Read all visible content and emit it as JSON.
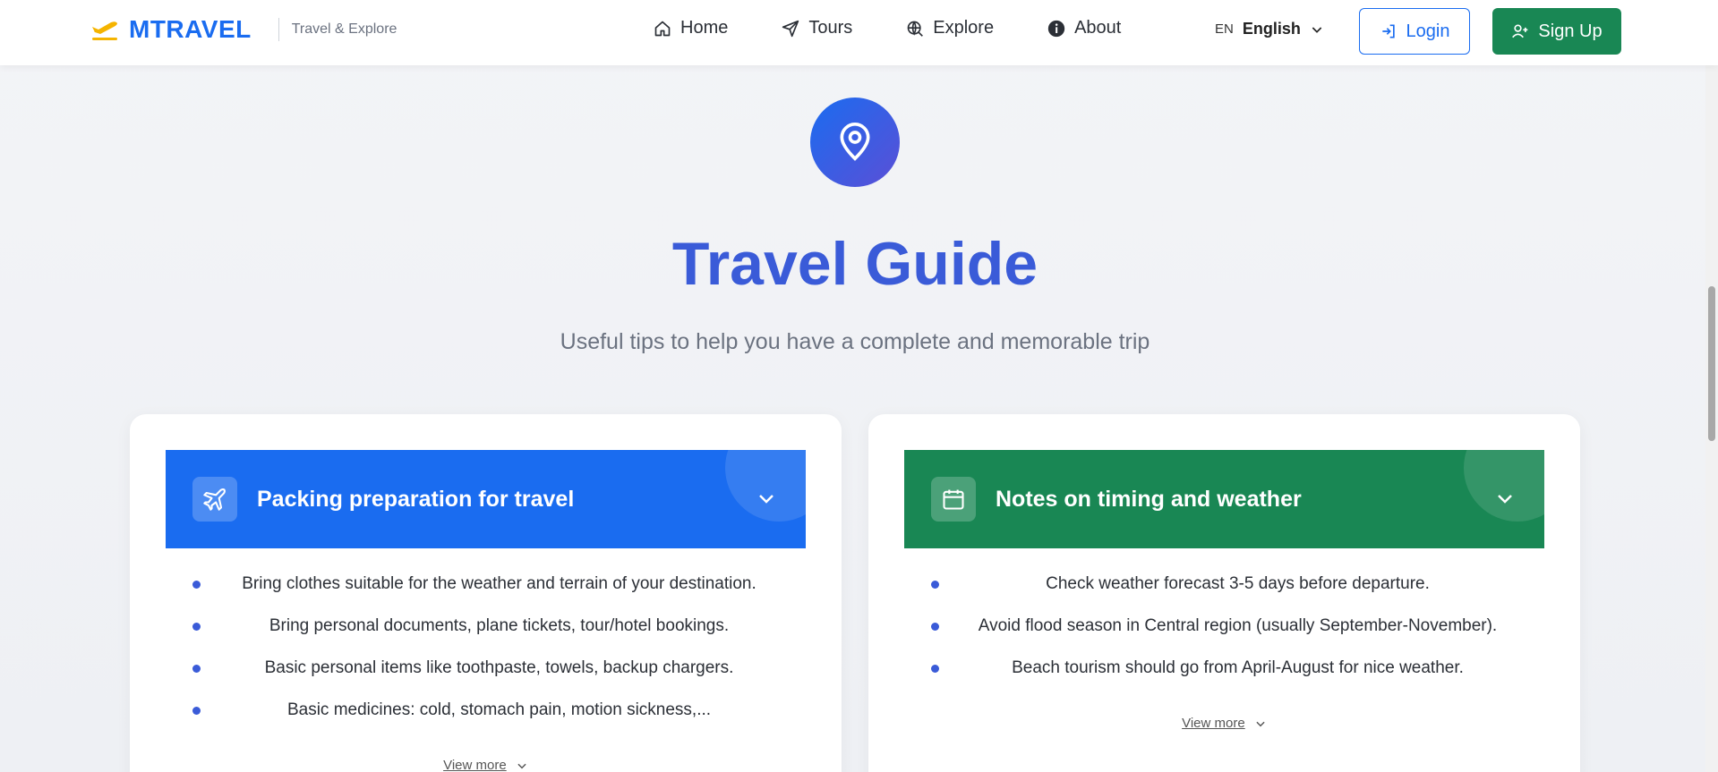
{
  "header": {
    "brand_name": "MTRAVEL",
    "brand_tagline": "Travel & Explore",
    "nav": [
      {
        "label": "Home",
        "icon": "home-icon"
      },
      {
        "label": "Tours",
        "icon": "send-icon"
      },
      {
        "label": "Explore",
        "icon": "globe-search-icon"
      },
      {
        "label": "About",
        "icon": "info-icon"
      }
    ],
    "language_code": "EN",
    "language_name": "English",
    "login_label": "Login",
    "signup_label": "Sign Up"
  },
  "hero": {
    "icon": "map-pin-icon",
    "title": "Travel Guide",
    "subtitle": "Useful tips to help you have a complete and memorable trip"
  },
  "cards": [
    {
      "title": "Packing preparation for travel",
      "icon": "plane-icon",
      "color": "#1a6cf0",
      "tips": [
        "Bring clothes suitable for the weather and terrain of your destination.",
        "Bring personal documents, plane tickets, tour/hotel bookings.",
        "Basic personal items like toothpaste, towels, backup chargers.",
        "Basic medicines: cold, stomach pain, motion sickness,..."
      ],
      "view_more": "View more"
    },
    {
      "title": "Notes on timing and weather",
      "icon": "calendar-icon",
      "color": "#198754",
      "tips": [
        "Check weather forecast 3-5 days before departure.",
        "Avoid flood season in Central region (usually September-November).",
        "Beach tourism should go from April-August for nice weather."
      ],
      "view_more": "View more"
    }
  ],
  "colors": {
    "brand": "#1a6cf0",
    "success": "#198754",
    "title": "#3a5bd8",
    "logo_accent": "#f5b400"
  }
}
